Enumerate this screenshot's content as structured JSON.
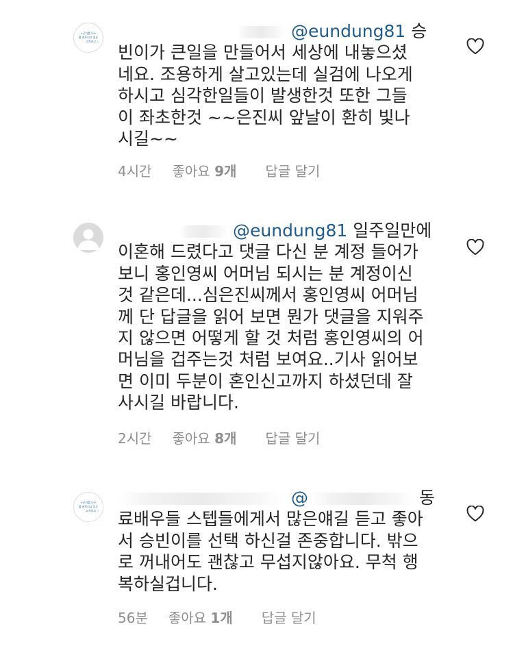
{
  "comments": [
    {
      "mention": "@eundung81",
      "lines": [
        "승",
        "빈이가 큰일을 만들어서 세상에  내놓으셨",
        "네요.  조용하게 살고있는데  실검에 나오게",
        "하시고  심각한일들이 발생한것  또한 그들",
        "이 좌초한것 ~~은진씨 앞날이 환히  빛나",
        "시길~~"
      ],
      "time": "4시간",
      "likes_label": "좋아요",
      "likes_count": "9개",
      "reply_label": "답글 달기",
      "avatar_text": [
        "+군기를 나누",
        "를 캐트리고 있는",
        "고치려고 ㅅ"
      ]
    },
    {
      "mention": "@eundung81",
      "lines": [
        "일주일만에",
        "이혼해 드렸다고 댓글 다신 분 계정 들어가",
        "보니 홍인영씨 어머님 되시는 분 계정이신",
        "것 같은데...심은진씨께서 홍인영씨 어머님",
        "께 단 답글을 읽어 보면 뭔가 댓글을 지워주",
        "지 않으면 어떻게 할 것 처럼 홍인영씨의 어",
        "머님을 겁주는것 처럼 보여요..기사 읽어보",
        "면 이미 두분이 혼인신고까지 하셨던데 잘",
        "사시길 바랍니다."
      ],
      "time": "2시간",
      "likes_label": "좋아요",
      "likes_count": "8개",
      "reply_label": "답글 달기"
    },
    {
      "mention": "@",
      "lines": [
        "동",
        "료배우들 스텝들에게서 많은얘길 듣고 좋아",
        "서 승빈이를 선택 하신걸  존중합니다. 밖으",
        "로 꺼내어도 괜찮고 무섭지않아요. 무척 행",
        "복하실겁니다."
      ],
      "time": "56분",
      "likes_label": "좋아요",
      "likes_count": "1개",
      "reply_label": "답글 달기",
      "avatar_text": [
        "+군기를 나누",
        "를 캐트리고 있는",
        "고치려고 ㅅ"
      ]
    }
  ],
  "icons": {
    "like": "heart-outline-icon",
    "default_avatar": "default-profile-icon"
  },
  "colors": {
    "text": "#262626",
    "meta": "#8e8e8e",
    "mention": "#1f5c8e",
    "heart_stroke": "#262626"
  }
}
